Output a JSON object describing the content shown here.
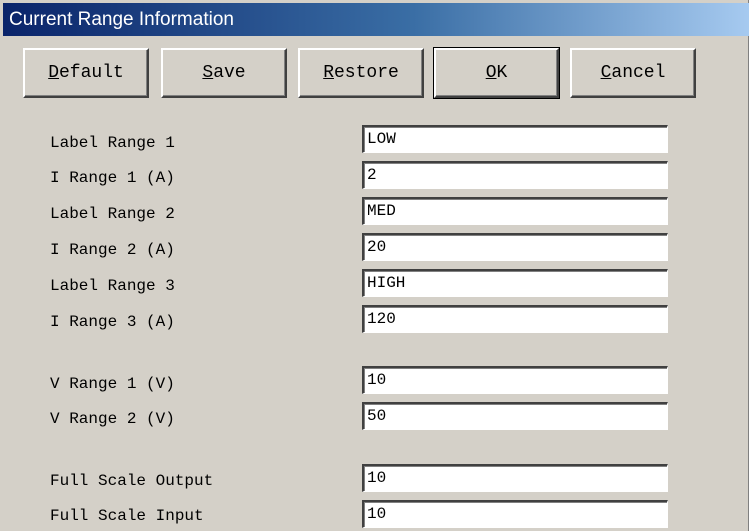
{
  "window": {
    "title": "Current Range Information",
    "colors": {
      "face": "#d4d0c8",
      "title_start": "#0a246a",
      "title_end": "#a6caf0"
    }
  },
  "buttons": [
    {
      "id": "default",
      "pre": "",
      "mnemonic": "D",
      "post": "efault"
    },
    {
      "id": "save",
      "pre": "",
      "mnemonic": "S",
      "post": "ave"
    },
    {
      "id": "restore",
      "pre": "",
      "mnemonic": "R",
      "post": "estore"
    },
    {
      "id": "ok",
      "pre": "",
      "mnemonic": "O",
      "post": "K"
    },
    {
      "id": "cancel",
      "pre": "",
      "mnemonic": "C",
      "post": "ancel"
    }
  ],
  "fields": [
    {
      "label": "Label Range 1",
      "value": "LOW"
    },
    {
      "label": "I Range 1 (A)",
      "value": "2"
    },
    {
      "label": "Label Range 2",
      "value": "MED"
    },
    {
      "label": "I Range 2 (A)",
      "value": "20"
    },
    {
      "label": "Label Range 3",
      "value": "HIGH"
    },
    {
      "label": "I Range 3 (A)",
      "value": "120"
    },
    {
      "label": "V Range 1 (V)",
      "value": "10"
    },
    {
      "label": "V Range 2 (V)",
      "value": "50"
    },
    {
      "label": "Full Scale Output",
      "value": "10"
    },
    {
      "label": "Full Scale Input",
      "value": "10"
    }
  ]
}
